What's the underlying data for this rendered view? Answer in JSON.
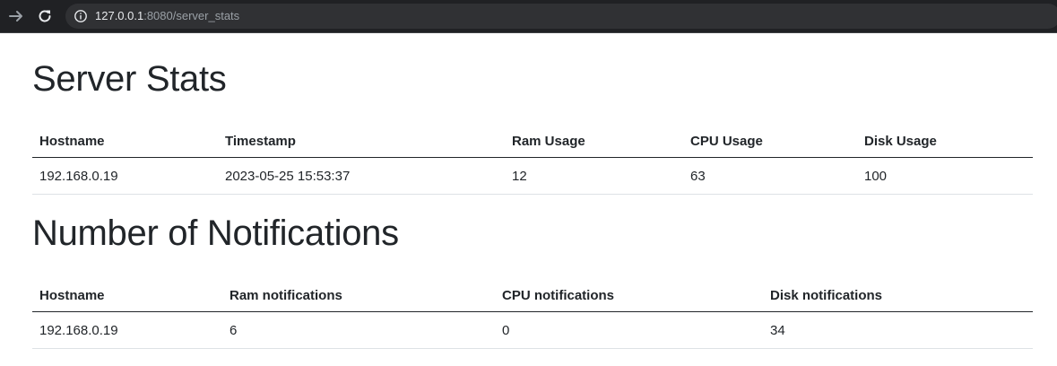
{
  "browser": {
    "url_host": "127.0.0.1",
    "url_rest": ":8080/server_stats"
  },
  "server_stats": {
    "title": "Server Stats",
    "headers": [
      "Hostname",
      "Timestamp",
      "Ram Usage",
      "CPU Usage",
      "Disk Usage"
    ],
    "rows": [
      [
        "192.168.0.19",
        "2023-05-25 15:53:37",
        "12",
        "63",
        "100"
      ]
    ]
  },
  "notifications": {
    "title": "Number of Notifications",
    "headers": [
      "Hostname",
      "Ram notifications",
      "CPU notifications",
      "Disk notifications"
    ],
    "rows": [
      [
        "192.168.0.19",
        "6",
        "0",
        "34"
      ]
    ]
  },
  "icons": {
    "forward": "arrow-forward-icon",
    "reload": "reload-icon",
    "info": "info-icon"
  }
}
